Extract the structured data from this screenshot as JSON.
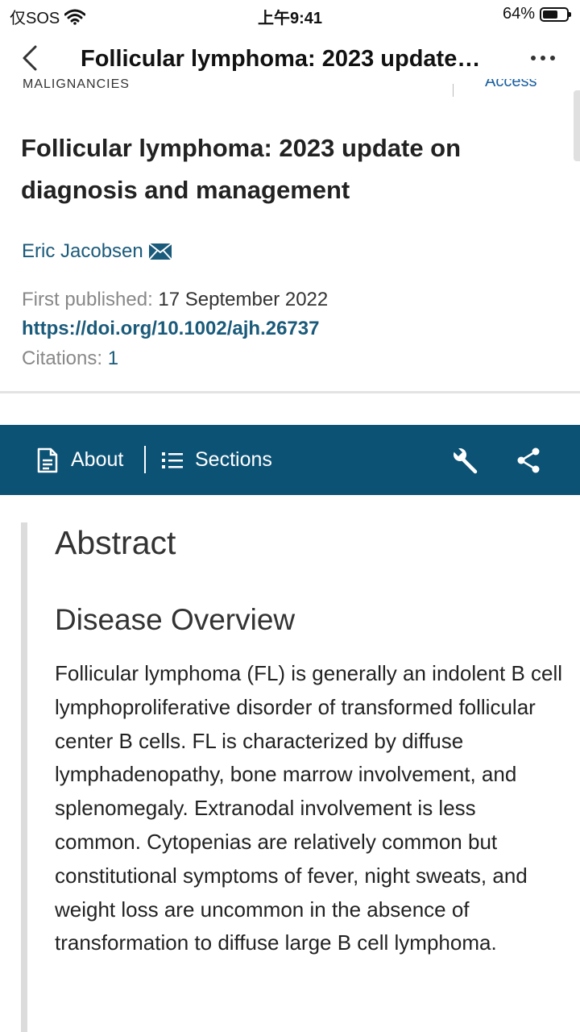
{
  "status_bar": {
    "carrier": "仅SOS",
    "time": "上午9:41",
    "battery_percent_label": "64%",
    "battery_level": 0.64
  },
  "nav": {
    "title": "Follicular lymphoma: 2023 update on diagnosis and management",
    "icons": [
      "chevron-left-icon",
      "more-icon"
    ]
  },
  "cut_header": {
    "category": "MALIGNANCIES",
    "access": "Access"
  },
  "article": {
    "title": "Follicular lymphoma: 2023 update on diagnosis and management",
    "author": "Eric Jacobsen",
    "published_label": "First published:",
    "published_date": "17 September 2022",
    "doi": "https://doi.org/10.1002/ajh.26737",
    "citations_label": "Citations:",
    "citations_count": "1"
  },
  "toolbar": {
    "about_label": "About",
    "sections_label": "Sections",
    "icons": [
      "document-icon",
      "list-icon",
      "wrench-icon",
      "share-icon"
    ]
  },
  "abstract": {
    "heading": "Abstract",
    "section_heading": "Disease Overview",
    "body": "Follicular lymphoma (FL) is generally an indolent B cell lymphoproliferative disorder of transformed follicular center B cells. FL is characterized by diffuse lymphadenopathy, bone marrow involvement, and splenomegaly. Extranodal involvement is less common. Cytopenias are relatively common but constitutional symptoms of fever, night sweats, and weight loss are uncommon in the absence of transformation to diffuse large B cell lymphoma."
  },
  "colors": {
    "toolbar_bg": "#0c5275",
    "link": "#1a5a7a",
    "muted": "#888888"
  }
}
